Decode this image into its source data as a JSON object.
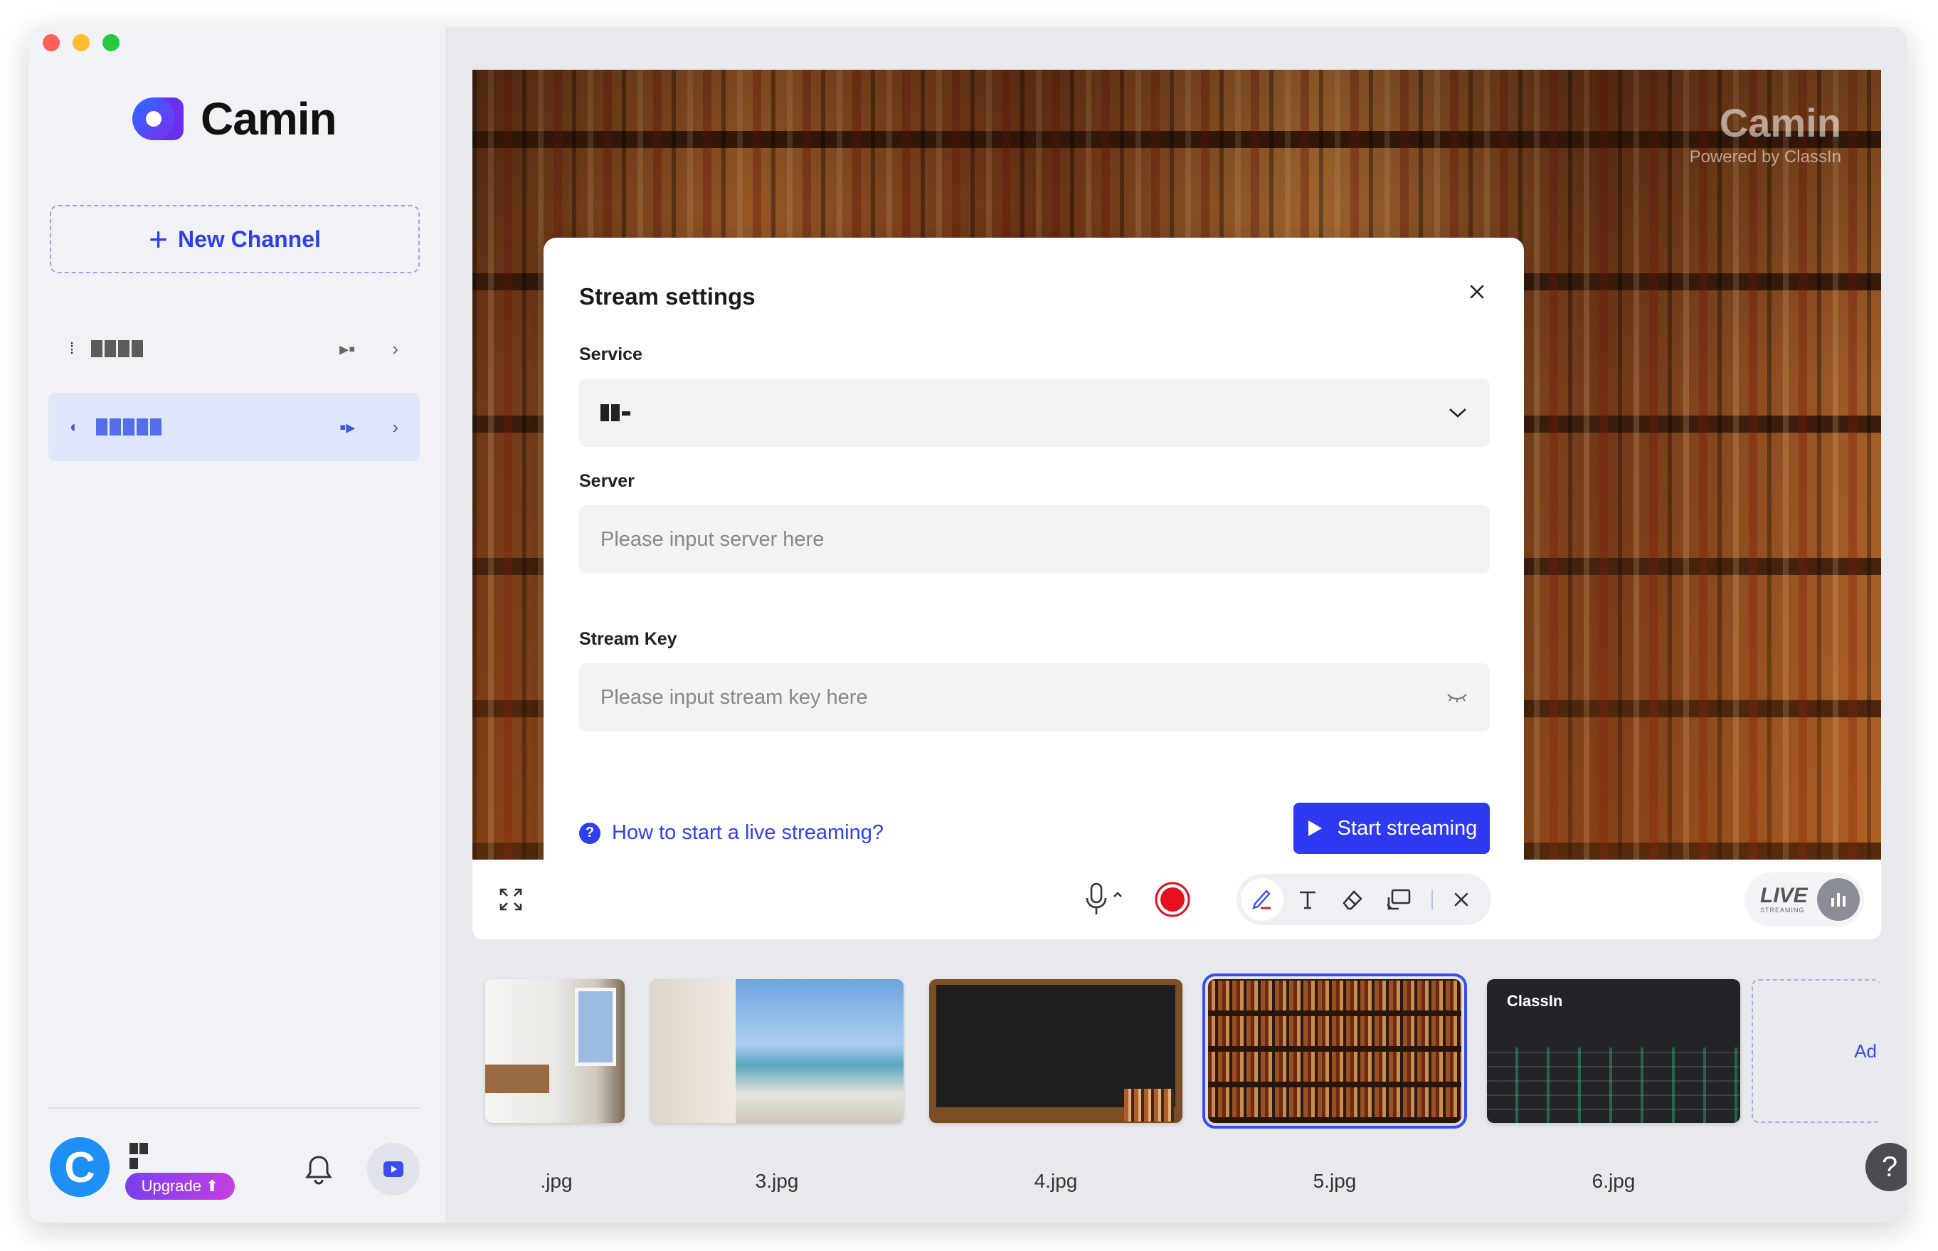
{
  "window": {
    "traffic_colors": [
      "#ff5f57",
      "#febc2e",
      "#28c840"
    ]
  },
  "sidebar": {
    "brand_name": "Camin",
    "new_channel_label": "New Channel",
    "channels": [
      {
        "name": "redacted",
        "active": false
      },
      {
        "name": "redacted",
        "active": true
      }
    ],
    "user": {
      "avatar_initial": "C",
      "upgrade_label": "Upgrade"
    }
  },
  "stage": {
    "watermark_title": "Camin",
    "watermark_subtitle": "Powered by ClassIn"
  },
  "modal": {
    "title": "Stream settings",
    "service_label": "Service",
    "server_label": "Server",
    "server_placeholder": "Please input server here",
    "stream_key_label": "Stream Key",
    "stream_key_placeholder": "Please input stream key here",
    "help_link": "How to start a live streaming?",
    "start_button": "Start streaming"
  },
  "toolbar": {
    "live_label": "LIVE",
    "live_sub": "STREAMING",
    "record_color": "#e8101f"
  },
  "thumbnails": [
    {
      "label": ".jpg",
      "selected": false
    },
    {
      "label": "3.jpg",
      "selected": false
    },
    {
      "label": "4.jpg",
      "selected": false
    },
    {
      "label": "5.jpg",
      "selected": true
    },
    {
      "label": "6.jpg",
      "selected": false
    }
  ],
  "thumb6_brand": "ClassIn",
  "add_label": "Ad",
  "help_label": "?",
  "accent_color": "#2f3ff0"
}
